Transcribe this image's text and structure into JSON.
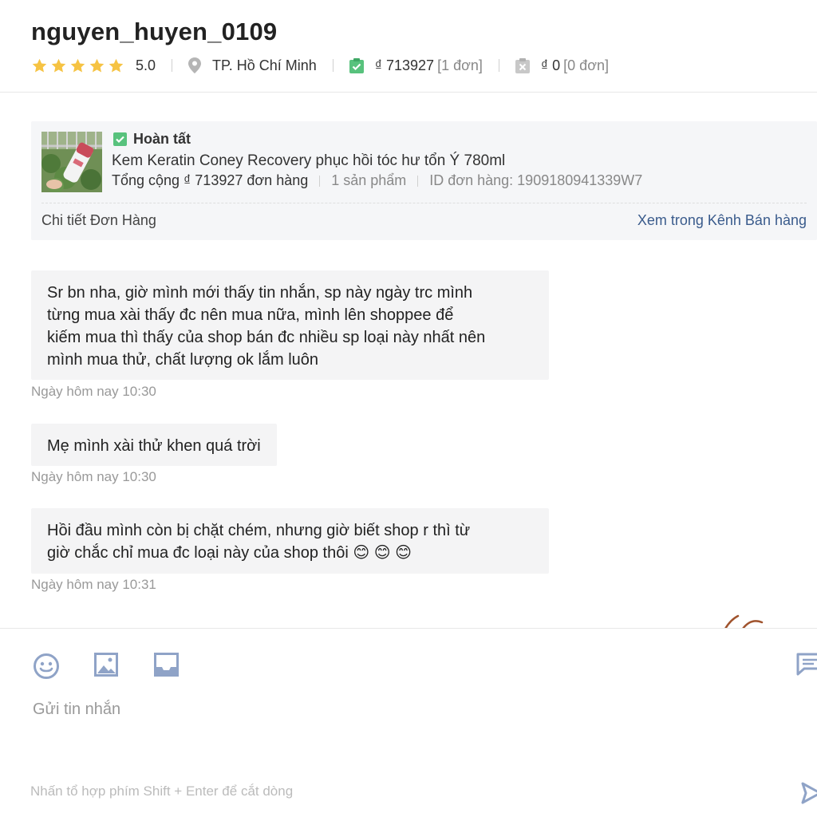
{
  "header": {
    "username": "nguyen_huyen_0109",
    "rating": "5.0",
    "stars": 5,
    "location": "TP. Hồ Chí Minh",
    "completed_amount": "₫ 713927",
    "completed_count": "[1 đơn]",
    "cancelled_amount": "₫ 0",
    "cancelled_count": "[0 đơn]"
  },
  "order": {
    "status": "Hoàn tất",
    "product_name": "Kem Keratin Coney Recovery phục hồi tóc hư tổn Ý 780ml",
    "total": "Tổng cộng ₫ 713927 đơn hàng",
    "quantity": "1 sản phẩm",
    "order_id": "ID đơn hàng: 1909180941339W7",
    "detail_label": "Chi tiết Đơn Hàng",
    "view_link": "Xem trong Kênh Bán hàng"
  },
  "messages": [
    {
      "lines": [
        "Sr bn nha, giờ mình mới thấy tin nhắn, sp này ngày trc mình",
        "từng mua xài thấy đc nên mua nữa, mình lên shoppee để",
        "kiếm mua thì thấy của shop bán đc nhiều sp loại này nhất nên",
        "mình mua thử, chất lượng ok lắm luôn"
      ],
      "time": "Ngày hôm nay 10:30"
    },
    {
      "lines": [
        "Mẹ mình xài thử khen quá trời"
      ],
      "time": "Ngày hôm nay 10:30"
    },
    {
      "lines": [
        "Hồi đầu mình còn bị chặt chém, nhưng giờ biết shop r thì từ",
        "giờ chắc chỉ mua đc loại này của shop thôi 😊 😊 😊"
      ],
      "time": "Ngày hôm nay 10:31"
    }
  ],
  "composer": {
    "placeholder": "Gửi tin nhắn",
    "hint": "Nhấn tổ hợp phím Shift + Enter để cắt dòng"
  },
  "colors": {
    "star": "#f6c343",
    "check": "#58c27d",
    "link": "#3a5b8c",
    "tool_icon": "#8fa3c7"
  }
}
